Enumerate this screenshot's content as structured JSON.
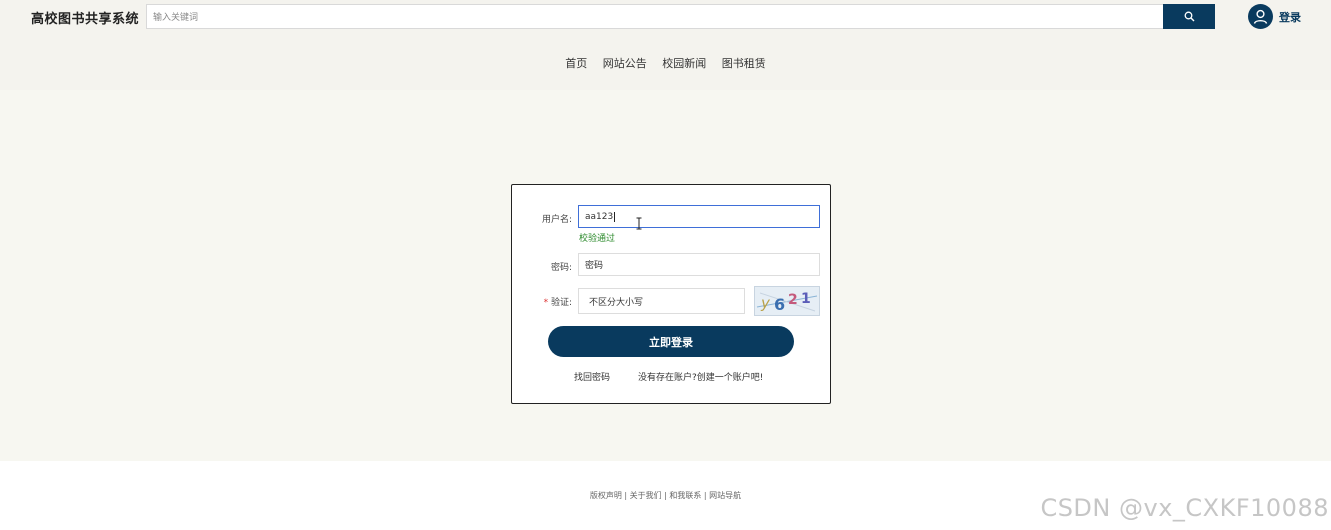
{
  "header": {
    "site_title": "高校图书共享系统",
    "search_placeholder": "输入关键词",
    "search_icon": "search-icon",
    "user_icon": "user-avatar-icon",
    "login_label": "登录"
  },
  "nav": {
    "items": [
      {
        "label": "首页"
      },
      {
        "label": "网站公告"
      },
      {
        "label": "校园新闻"
      },
      {
        "label": "图书租赁"
      }
    ]
  },
  "login_form": {
    "username_label": "用户名:",
    "username_value": "aa123",
    "username_validation": "校验通过",
    "password_label": "密码:",
    "password_value": "密码",
    "captcha_required_mark": "*",
    "captcha_label": "验证:",
    "captcha_placeholder": "不区分大小写",
    "captcha_text": "y621",
    "submit_label": "立即登录",
    "forgot_password": "找回密码",
    "register_prompt": "没有存在账户?创建一个账户吧!"
  },
  "footer": {
    "links": "版权声明 | 关于我们 | 和我联系 | 网站导航",
    "watermark": "CSDN @vx_CXKF10088"
  },
  "colors": {
    "primary": "#093a5e",
    "header_bg": "#f4f3ee",
    "page_bg": "#f7f7f1",
    "success": "#2e8b2e"
  }
}
